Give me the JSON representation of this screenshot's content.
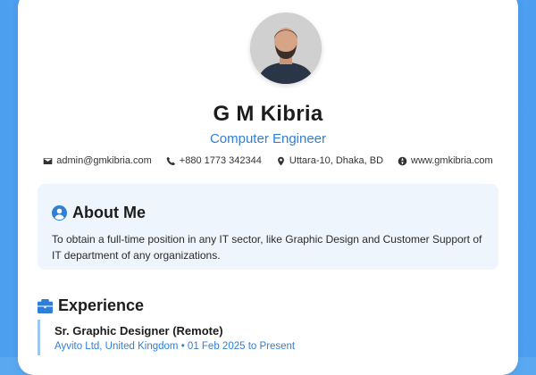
{
  "profile": {
    "name": "G M Kibria",
    "role": "Computer Engineer"
  },
  "contacts": [
    {
      "icon": "envelope-icon",
      "text": "admin@gmkibria.com"
    },
    {
      "icon": "phone-icon",
      "text": "+880 1773 342344"
    },
    {
      "icon": "location-pin-icon",
      "text": "Uttara-10, Dhaka, BD"
    },
    {
      "icon": "globe-icon",
      "text": "www.gmkibria.com"
    }
  ],
  "about": {
    "title": "About Me",
    "icon": "user-circle-icon",
    "text": "To obtain a full-time position in any IT sector, like Graphic Design and Customer Support of IT department of any organizations."
  },
  "experience": {
    "title": "Experience",
    "icon": "briefcase-icon",
    "items": [
      {
        "job_title": "Sr. Graphic Designer (Remote)",
        "meta": "Ayvito Ltd, United Kingdom • 01 Feb 2025 to Present"
      }
    ]
  },
  "colors": {
    "accent": "#2f7fd8",
    "background": "#5aa9f0",
    "about_panel": "#eef5fd"
  }
}
